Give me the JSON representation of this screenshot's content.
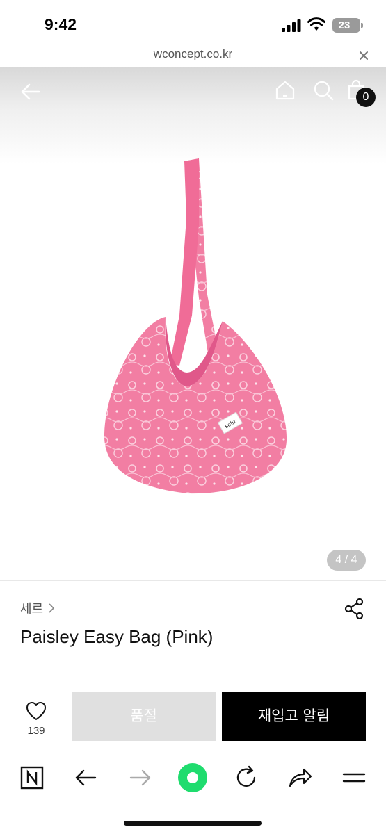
{
  "status_bar": {
    "time": "9:42",
    "battery": "23"
  },
  "browser": {
    "url": "wconcept.co.kr",
    "close_icon": "close-icon"
  },
  "header": {
    "cart_count": "0",
    "icons": [
      "back-arrow-icon",
      "home-icon",
      "search-icon",
      "cart-icon"
    ]
  },
  "gallery": {
    "counter": "4 / 4",
    "current": 4,
    "total": 4,
    "product_color": "#f27ea3"
  },
  "product": {
    "brand": "세르",
    "title": "Paisley Easy Bag (Pink)",
    "tag_text": "sehr"
  },
  "actions": {
    "like_count": "139",
    "soldout_label": "품절",
    "restock_label": "재입고 알림"
  },
  "toolbar": {
    "icons": [
      "naver-n-icon",
      "back-icon",
      "forward-icon",
      "green-dot-icon",
      "refresh-icon",
      "share-icon",
      "menu-icon"
    ],
    "accent": "#1fdc6e"
  }
}
